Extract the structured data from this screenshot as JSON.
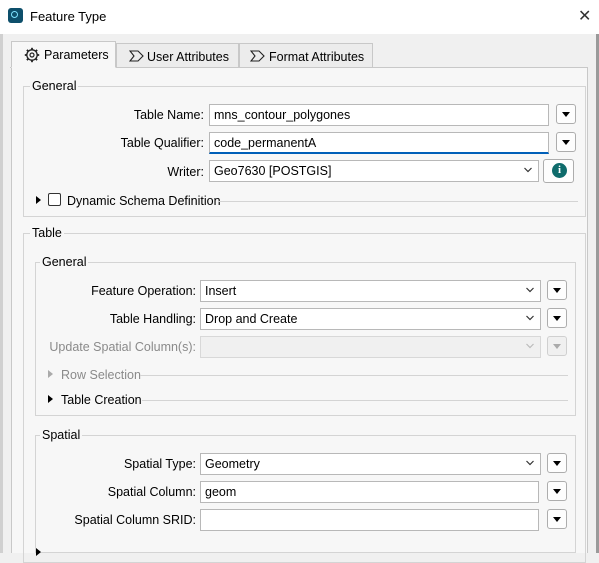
{
  "window": {
    "title": "Feature Type",
    "close_glyph": "✕",
    "icon": "app-icon"
  },
  "tabs": [
    {
      "label": "Parameters",
      "icon": "gear-icon",
      "active": true
    },
    {
      "label": "User Attributes",
      "icon": "chevron-tab-icon",
      "active": false
    },
    {
      "label": "Format Attributes",
      "icon": "chevron-tab-icon",
      "active": false
    }
  ],
  "general": {
    "title": "General",
    "table_name_label": "Table Name:",
    "table_name_value": "mns_contour_polygones",
    "table_qualifier_label": "Table Qualifier:",
    "table_qualifier_value": "code_permanentA",
    "writer_label": "Writer:",
    "writer_value": "Geo7630 [POSTGIS]",
    "info_glyph": "i",
    "dynamic_schema_label": "Dynamic Schema Definition",
    "dynamic_schema_checked": false
  },
  "table": {
    "title": "Table",
    "general": {
      "title": "General",
      "feature_operation_label": "Feature Operation:",
      "feature_operation_value": "Insert",
      "table_handling_label": "Table Handling:",
      "table_handling_value": "Drop and Create",
      "update_spatial_label": "Update Spatial Column(s):",
      "update_spatial_value": "",
      "row_selection_label": "Row Selection",
      "table_creation_label": "Table Creation"
    },
    "spatial": {
      "title": "Spatial",
      "spatial_type_label": "Spatial Type:",
      "spatial_type_value": "Geometry",
      "spatial_column_label": "Spatial Column:",
      "spatial_column_value": "geom",
      "srid_label": "Spatial Column SRID:",
      "srid_value": ""
    }
  },
  "colors": {
    "accent": "#005fb8",
    "info": "#0e6b6b"
  }
}
